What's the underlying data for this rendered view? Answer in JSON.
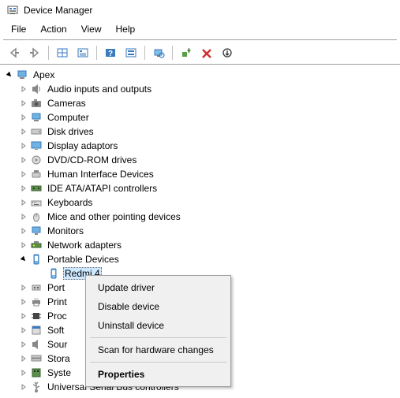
{
  "window": {
    "title": "Device Manager"
  },
  "menubar": [
    "File",
    "Action",
    "View",
    "Help"
  ],
  "tree": {
    "root": "Apex",
    "categories": [
      {
        "label": "Audio inputs and outputs",
        "expanded": false
      },
      {
        "label": "Cameras",
        "expanded": false
      },
      {
        "label": "Computer",
        "expanded": false
      },
      {
        "label": "Disk drives",
        "expanded": false
      },
      {
        "label": "Display adaptors",
        "expanded": false
      },
      {
        "label": "DVD/CD-ROM drives",
        "expanded": false
      },
      {
        "label": "Human Interface Devices",
        "expanded": false
      },
      {
        "label": "IDE ATA/ATAPI controllers",
        "expanded": false
      },
      {
        "label": "Keyboards",
        "expanded": false
      },
      {
        "label": "Mice and other pointing devices",
        "expanded": false
      },
      {
        "label": "Monitors",
        "expanded": false
      },
      {
        "label": "Network adapters",
        "expanded": false
      },
      {
        "label": "Portable Devices",
        "expanded": true,
        "children": [
          {
            "label": "Redmi 4",
            "selected": true
          }
        ]
      },
      {
        "label": "Port",
        "expanded": false,
        "truncated": true
      },
      {
        "label": "Print",
        "expanded": false,
        "truncated": true
      },
      {
        "label": "Proc",
        "expanded": false,
        "truncated": true
      },
      {
        "label": "Soft",
        "expanded": false,
        "truncated": true
      },
      {
        "label": "Sour",
        "expanded": false,
        "truncated": true
      },
      {
        "label": "Stora",
        "expanded": false,
        "truncated": true
      },
      {
        "label": "Syste",
        "expanded": false,
        "truncated": true
      },
      {
        "label": "Universal Serial Bus controllers",
        "expanded": false
      }
    ]
  },
  "context_menu": {
    "items": [
      {
        "label": "Update driver"
      },
      {
        "label": "Disable device"
      },
      {
        "label": "Uninstall device"
      },
      {
        "separator": true
      },
      {
        "label": "Scan for hardware changes"
      },
      {
        "separator": true
      },
      {
        "label": "Properties",
        "bold": true
      }
    ]
  }
}
